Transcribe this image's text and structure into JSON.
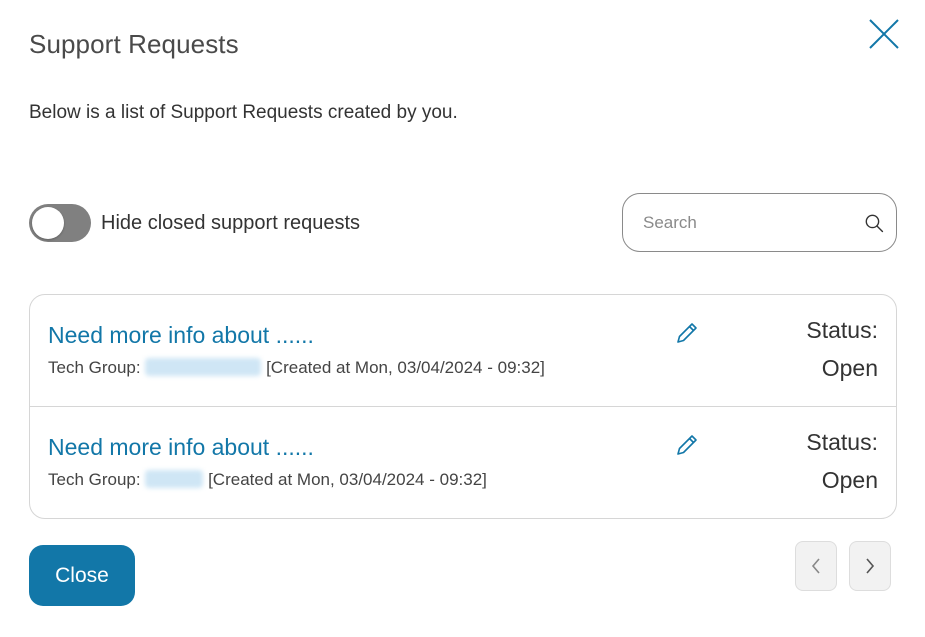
{
  "dialog": {
    "title": "Support Requests",
    "subtitle": "Below is a list of Support Requests created by you.",
    "close_icon": "close-x-icon"
  },
  "filters": {
    "toggle_label": "Hide closed support requests",
    "toggle_on": false,
    "search_placeholder": "Search",
    "search_value": "",
    "search_icon": "search-icon"
  },
  "requests": [
    {
      "title": "Need more info about ......",
      "tech_group_label": "Tech Group:",
      "created": "[Created at Mon, 03/04/2024 - 09:32]",
      "status_label": "Status:",
      "status_value": "Open",
      "edit_icon": "pencil-icon"
    },
    {
      "title": "Need more info about ......",
      "tech_group_label": "Tech Group:",
      "created": "[Created at Mon, 03/04/2024 - 09:32]",
      "status_label": "Status:",
      "status_value": "Open",
      "edit_icon": "pencil-icon"
    }
  ],
  "footer": {
    "close_label": "Close",
    "prev_icon": "chevron-left-icon",
    "next_icon": "chevron-right-icon"
  },
  "colors": {
    "accent": "#1277a8",
    "toggle_off": "#808080",
    "border": "#d6d6d6"
  }
}
